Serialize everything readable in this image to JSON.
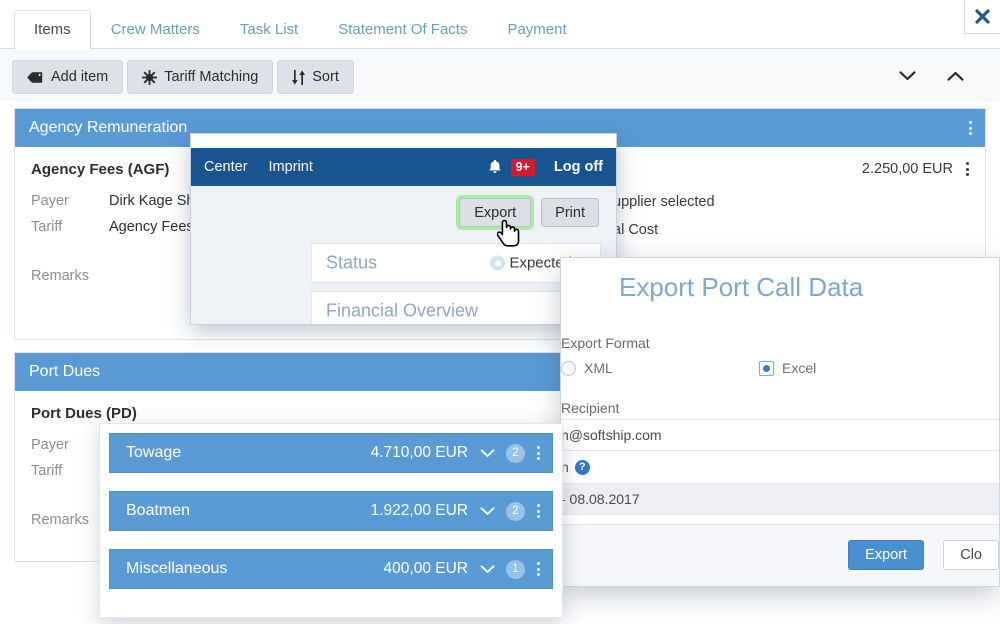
{
  "window": {
    "close_icon": "close-icon"
  },
  "tabs": [
    {
      "label": "Items",
      "active": true
    },
    {
      "label": "Crew Matters",
      "active": false
    },
    {
      "label": "Task List",
      "active": false
    },
    {
      "label": "Statement Of Facts",
      "active": false
    },
    {
      "label": "Payment",
      "active": false
    }
  ],
  "toolbar": {
    "add_item_label": "Add item",
    "add_item_icon": "tag-icon",
    "tariff_matching_label": "Tariff Matching",
    "tariff_matching_icon": "asterisk-icon",
    "sort_label": "Sort",
    "sort_icon": "sort-arrows-icon",
    "collapse_all_icon": "chevron-down-icon",
    "expand_all_icon": "chevron-up-icon"
  },
  "sections": [
    {
      "title": "Agency Remuneration",
      "kebab_icon": "kebab-menu-icon",
      "item_title": "Agency Fees (AGF)",
      "payer_label": "Payer",
      "payer_value": "Dirk Kage Sh",
      "tariff_label": "Tariff",
      "tariff_value": "Agency Fees",
      "remarks_label": "Remarks",
      "amount": "2.250,00 EUR",
      "supplier_note": "upplier selected",
      "cost_note": "al Cost"
    },
    {
      "title": "Port Dues",
      "kebab_icon": "kebab-menu-icon",
      "item_title": "Port Dues (PD)",
      "payer_label": "Payer",
      "tariff_label": "Tariff",
      "remarks_label": "Remarks"
    }
  ],
  "nav_window": {
    "links": [
      "Center",
      "Imprint"
    ],
    "bell_icon": "bell-icon",
    "notification_count": "9+",
    "log_off_label": "Log off",
    "export_label": "Export",
    "print_label": "Print",
    "status_label": "Status",
    "status_value": "Expected",
    "status_icon": "gear-icon",
    "status_caret_icon": "caret-down-icon",
    "financial_overview_label": "Financial Overview",
    "cursor_icon": "hand-pointer-cursor"
  },
  "export_dialog": {
    "title": "Export Port Call Data",
    "format_label": "Export Format",
    "format_options": [
      {
        "label": "XML",
        "selected": false
      },
      {
        "label": "Excel",
        "selected": true
      }
    ],
    "recipient_label": "Recipient",
    "recipient_value": "n@softship.com",
    "help_icon": "help-circle-icon",
    "date_label": "n",
    "date_value": "- 08.08.2017",
    "export_button": "Export",
    "close_button": "Clo"
  },
  "item_list": [
    {
      "name": "Towage",
      "amount": "4.710,00 EUR",
      "count": "2",
      "chevron_icon": "chevron-down-icon",
      "kebab_icon": "kebab-menu-icon"
    },
    {
      "name": "Boatmen",
      "amount": "1.922,00 EUR",
      "count": "2",
      "chevron_icon": "chevron-down-icon",
      "kebab_icon": "kebab-menu-icon"
    },
    {
      "name": "Miscellaneous",
      "amount": "400,00 EUR",
      "count": "1",
      "chevron_icon": "chevron-down-icon",
      "kebab_icon": "kebab-menu-icon"
    }
  ],
  "colors": {
    "accent_blue": "#5b9bd5",
    "nav_navy": "#18548f",
    "badge_red": "#d9182c",
    "highlight_green": "#a9eda0",
    "title_blue": "#7fa8cf"
  }
}
